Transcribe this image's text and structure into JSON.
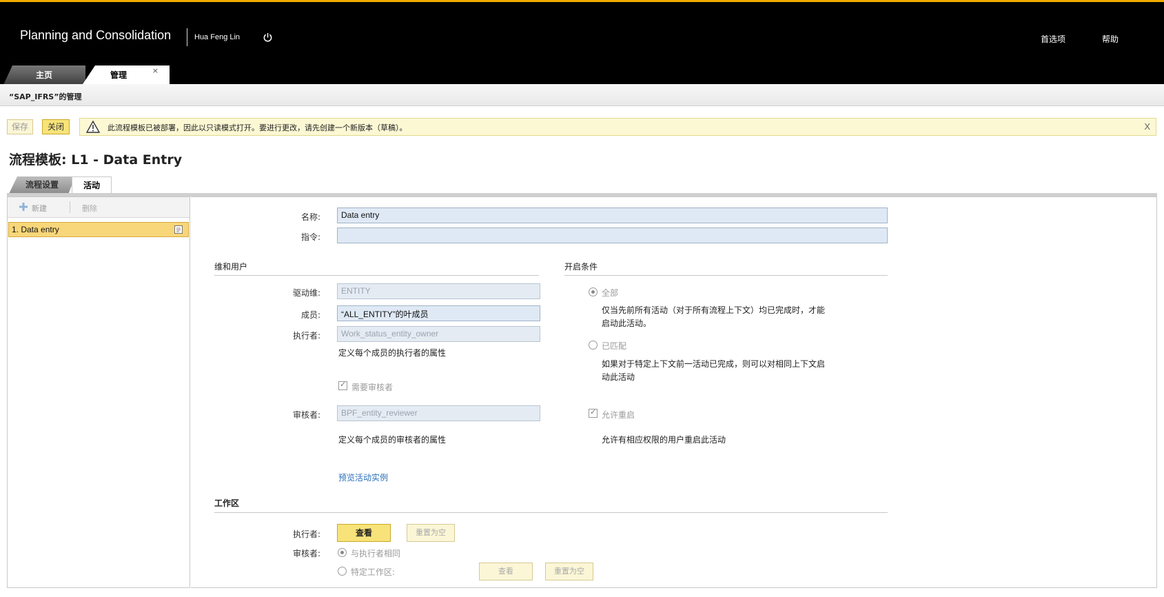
{
  "header": {
    "app_title": "Planning and Consolidation",
    "user_name": "Hua Feng Lin",
    "preferences": "首选项",
    "help": "帮助"
  },
  "main_tabs": {
    "home": "主页",
    "admin": "管理",
    "close": "×"
  },
  "subheader": {
    "title": "“SAP_IFRS”的管理"
  },
  "toolbar": {
    "save": "保存",
    "close": "关闭",
    "warning": "此流程模板已被部署，因此以只读模式打开。要进行更改，请先创建一个新版本（草稿）。",
    "warning_close": "X"
  },
  "page": {
    "title": "流程模板: L1 - Data Entry",
    "tabs": {
      "setup": "流程设置",
      "activity": "活动"
    }
  },
  "left_panel": {
    "new": "新建",
    "delete": "删除",
    "items": [
      {
        "label": "1. Data entry"
      }
    ]
  },
  "form": {
    "name_label": "名称:",
    "name_value": "Data entry",
    "instruction_label": "指令:",
    "instruction_value": "",
    "dim_user_title": "维和用户",
    "driver_dim_label": "驱动维:",
    "driver_dim_value": "ENTITY",
    "member_label": "成员:",
    "member_value": "“ALL_ENTITY”的叶成员",
    "performer_label": "执行者:",
    "performer_value": "Work_status_entity_owner",
    "performer_hint": "定义每个成员的执行者的属性",
    "need_reviewer": "需要审核者",
    "reviewer_label": "审核者:",
    "reviewer_value": "BPF_entity_reviewer",
    "reviewer_hint": "定义每个成员的审核者的属性",
    "preview_link": "预览活动实例",
    "open_cond_title": "开启条件",
    "all_option": "全部",
    "all_desc_1": "仅当先前所有活动（对于所有流程上下文）均已完成时，才能",
    "all_desc_2": "启动此活动。",
    "matched_option": "已匹配",
    "matched_desc_1": "如果对于特定上下文前一活动已完成，则可以对相同上下文启",
    "matched_desc_2": "动此活动",
    "allow_reopen": "允许重启",
    "allow_reopen_desc": "允许有相应权限的用户重启此活动",
    "workspace_title": "工作区",
    "ws_performer_label": "执行者:",
    "ws_view": "查看",
    "ws_reset": "重置为空",
    "ws_reviewer_label": "审核者:",
    "same_as_performer": "与执行者相同",
    "specific_workspace": "特定工作区:",
    "ws_view2": "查看",
    "ws_reset2": "重置为空"
  },
  "colors": {
    "accent": "#f0ab00",
    "selected_item": "#f8d67a",
    "warning_bg": "#fcf8d4",
    "input_bg": "#dfe9f5",
    "link": "#2a6fb8"
  },
  "icons": {
    "power": "power-icon",
    "warning": "warning-triangle-icon",
    "new": "plus-icon",
    "item": "item-detail-icon"
  }
}
